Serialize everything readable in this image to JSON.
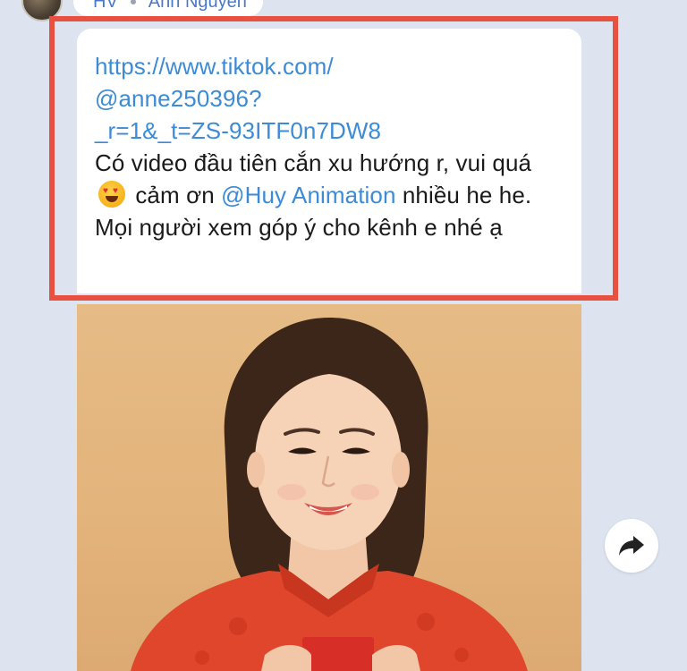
{
  "header": {
    "sender_role": "HV",
    "sender_name": "Anh Nguyen"
  },
  "message": {
    "link_lines": [
      "https://www.tiktok.com/",
      "@anne250396?",
      "_r=1&_t=ZS-93ITF0n7DW8"
    ],
    "text_part1": "Có video đầu tiên cắn xu hướng r, vui quá",
    "emoji": "heart-eyes-emoji",
    "text_part2": "cảm ơn",
    "mention": "@Huy Animation",
    "text_part3": "nhiều he he. Mọi người xem góp ý cho kênh e nhé ạ"
  },
  "colors": {
    "background": "#dde4f0",
    "link": "#3d8bd6",
    "highlight": "#e8503f",
    "photo_background": "#e3b47c",
    "dress": "#e0462c"
  },
  "icons": {
    "forward": "forward-arrow-icon"
  }
}
